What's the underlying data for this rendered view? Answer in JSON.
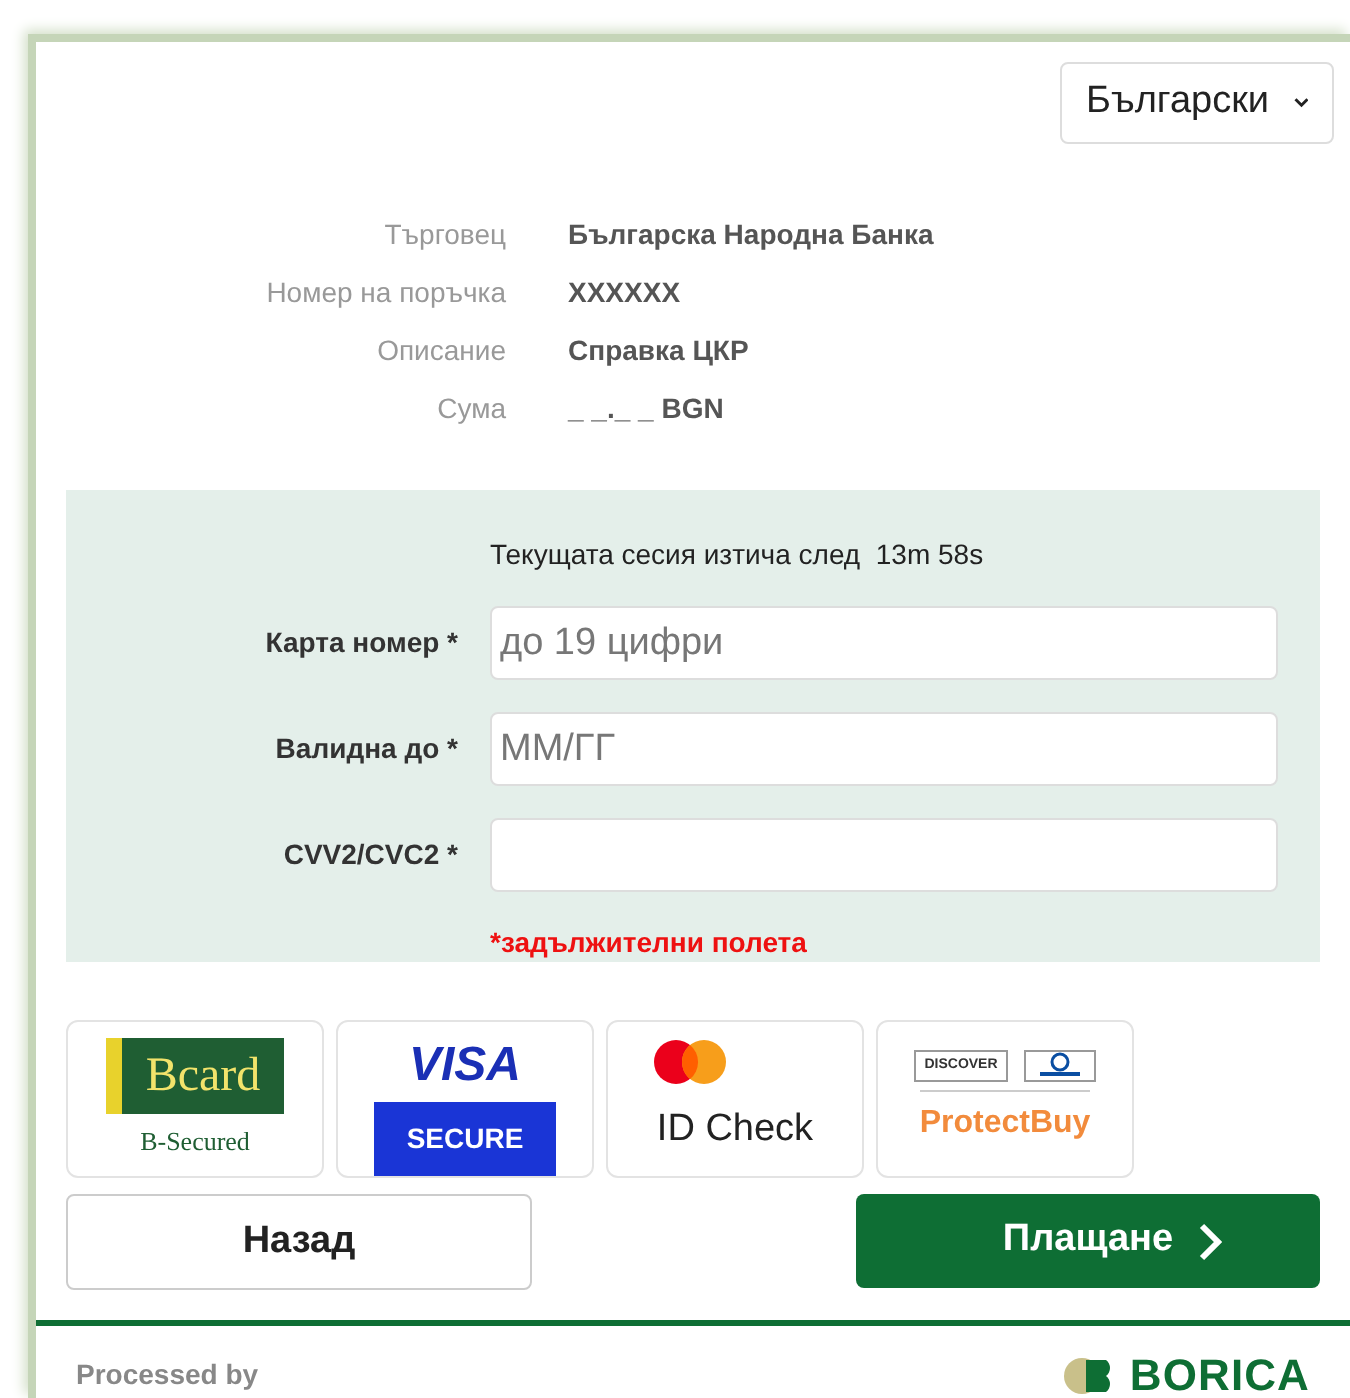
{
  "language_select": {
    "value": "Български"
  },
  "order_details": [
    {
      "label": "Търговец",
      "value": "Българска Народна Банка"
    },
    {
      "label": "Номер на поръчка",
      "value": "XXXXXX"
    },
    {
      "label": "Описание",
      "value": "Справка ЦКР"
    },
    {
      "label": "Сума",
      "value": "_ _._ _ BGN"
    }
  ],
  "session": {
    "text": "Текущата сесия изтича след",
    "remaining": "13m 58s"
  },
  "fields": [
    {
      "label": "Карта номер",
      "required_mark": "*",
      "placeholder": "до 19 цифри"
    },
    {
      "label": "Валидна до",
      "required_mark": "*",
      "placeholder": "ММ/ГГ"
    },
    {
      "label": "CVV2/CVC2",
      "required_mark": "*"
    }
  ],
  "required_note": "*задължителни полета",
  "security_logos": [
    {
      "kind": "bcard",
      "texts": [
        "Bcard",
        "B-Secured"
      ]
    },
    {
      "kind": "visa",
      "texts": [
        "VISA",
        "SECURE"
      ]
    },
    {
      "kind": "mastercard",
      "texts": [
        "ID Check"
      ]
    },
    {
      "kind": "protectbuy",
      "texts": [
        "DISCOVER",
        "ProtectBuy"
      ]
    }
  ],
  "buttons": {
    "back": "Назад",
    "pay": "Плащане"
  },
  "footer": {
    "processed_by": "Processed by",
    "brand": "BORICA"
  }
}
